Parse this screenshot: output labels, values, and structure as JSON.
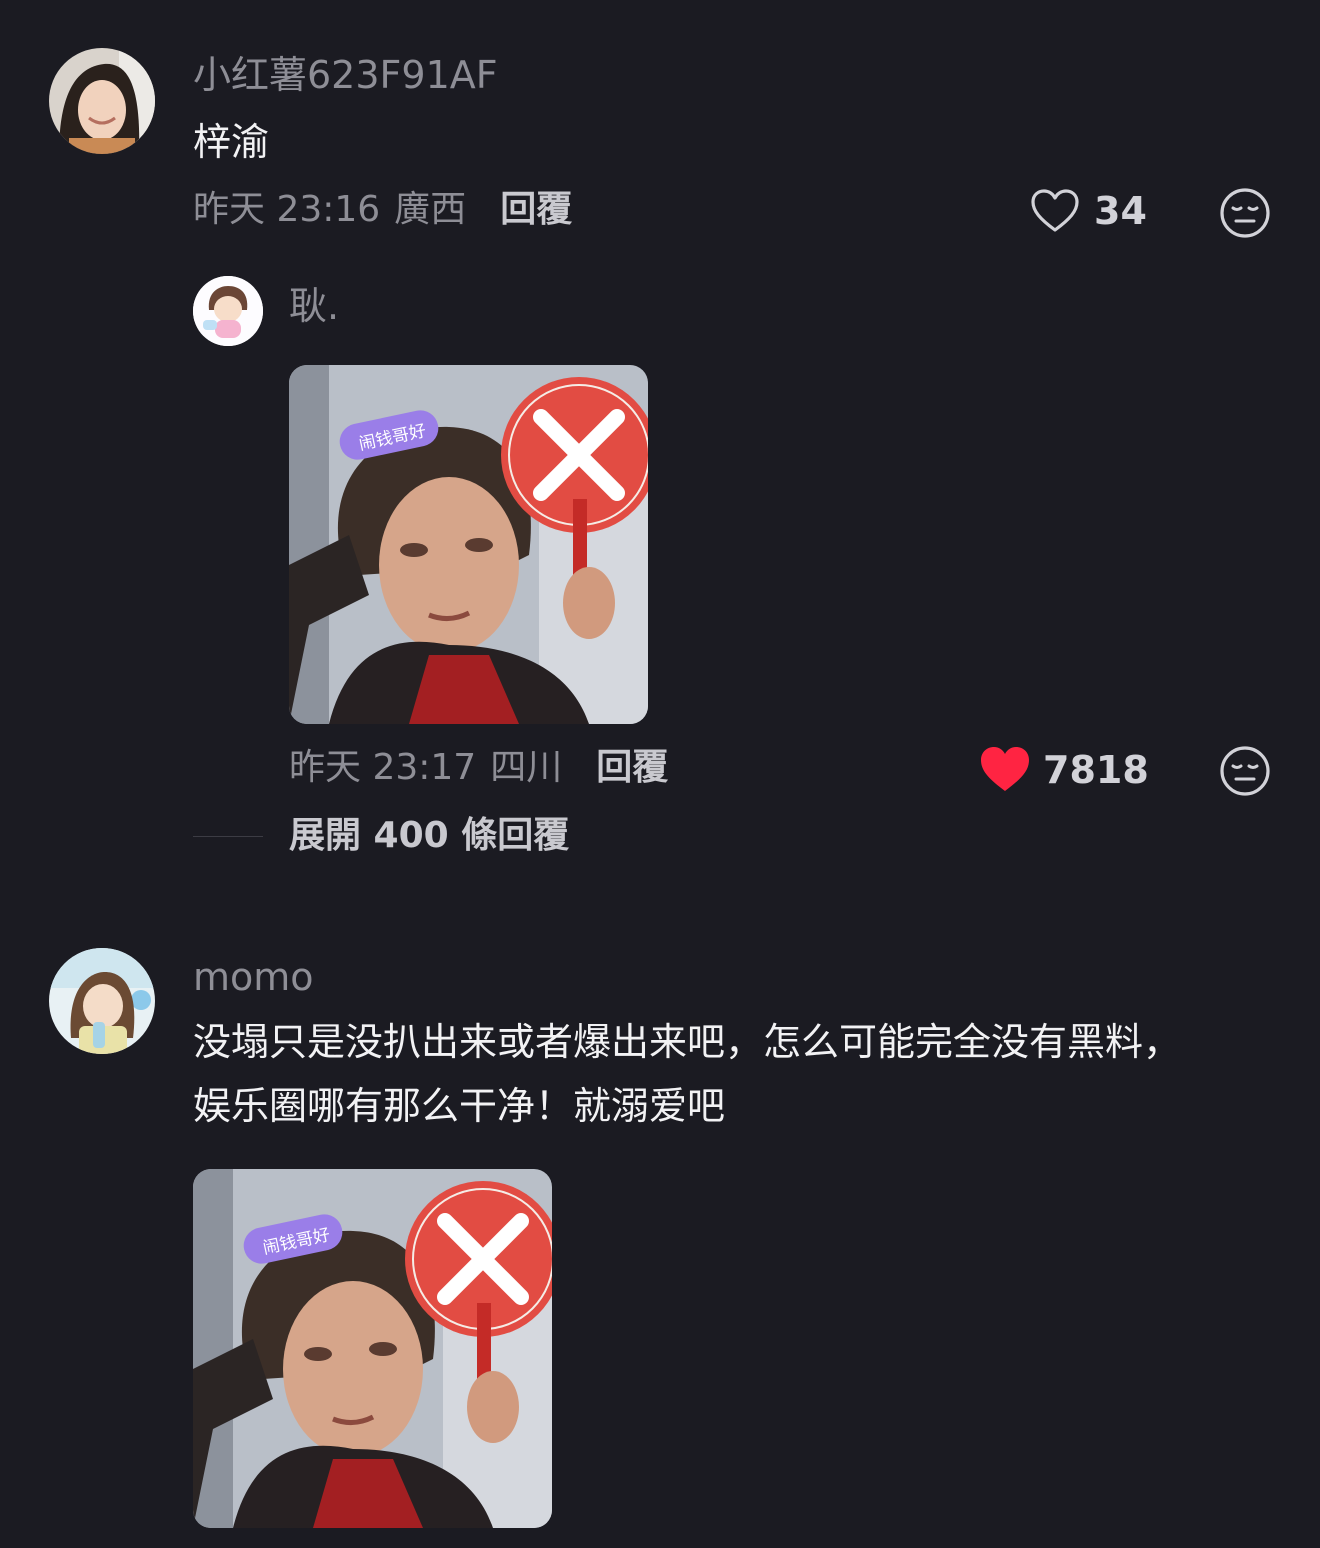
{
  "comments": [
    {
      "username": "小红薯623F91AF",
      "text": "梓渝",
      "time": "昨天 23:16",
      "location": "廣西",
      "reply_label": "回覆",
      "likes": "34",
      "liked": false,
      "reply": {
        "username": "耿.",
        "time": "昨天 23:17",
        "location": "四川",
        "reply_label": "回覆",
        "likes": "7818",
        "liked": true,
        "image_badge": "闹钱哥好",
        "image_desc": "meme-photo"
      },
      "expand_label": "展開 400 條回覆"
    },
    {
      "username": "momo",
      "text": "没塌只是没扒出来或者爆出来吧，怎么可能完全没有黑料，娱乐圈哪有那么干净！就溺爱吧",
      "image_badge": "闹钱哥好",
      "image_desc": "meme-photo"
    }
  ],
  "icons": {
    "like": "heart-outline-icon",
    "liked": "heart-filled-icon",
    "emoji": "neutral-face-icon"
  },
  "colors": {
    "background": "#1b1b22",
    "liked_heart": "#ff2442",
    "secondary_text": "#8e8e96"
  }
}
